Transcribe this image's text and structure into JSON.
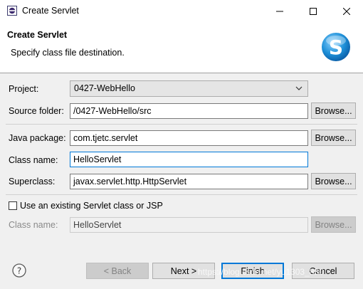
{
  "window": {
    "title": "Create Servlet",
    "controls": {
      "minimize": "minimize",
      "maximize": "maximize",
      "close": "close"
    }
  },
  "header": {
    "title": "Create Servlet",
    "description": "Specify class file destination.",
    "logo_letter": "S"
  },
  "form": {
    "project": {
      "label": "Project:",
      "value": "0427-WebHello"
    },
    "source_folder": {
      "label": "Source folder:",
      "value": "/0427-WebHello/src",
      "browse": "Browse..."
    },
    "java_package": {
      "label": "Java package:",
      "value": "com.tjetc.servlet",
      "browse": "Browse..."
    },
    "class_name": {
      "label": "Class name:",
      "value": "HelloServlet"
    },
    "superclass": {
      "label": "Superclass:",
      "value": "javax.servlet.http.HttpServlet",
      "browse": "Browse..."
    },
    "existing": {
      "checkbox_label": "Use an existing Servlet class or JSP",
      "checked": false,
      "class_name_label": "Class name:",
      "class_name_value": "HelloServlet",
      "browse": "Browse..."
    }
  },
  "footer": {
    "help": "?",
    "back": "< Back",
    "next": "Next >",
    "finish": "Finish",
    "cancel": "Cancel"
  },
  "watermark": "https://blog.csdn.net/yu1303_830",
  "colors": {
    "accent": "#0078d7",
    "logo_blue": "#1e90d8"
  }
}
